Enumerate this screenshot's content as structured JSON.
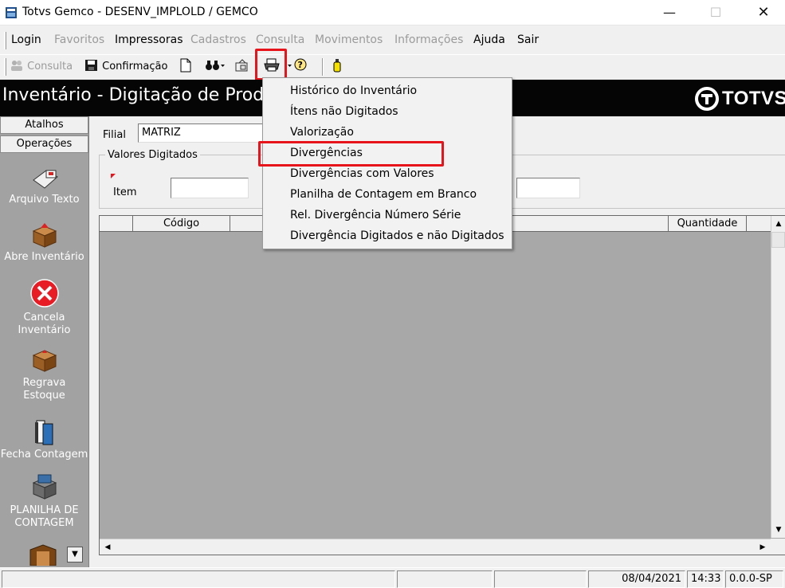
{
  "window": {
    "title": "Totvs Gemco - DESENV_IMPLOLD / GEMCO"
  },
  "menubar": {
    "items": [
      {
        "label": "Login",
        "enabled": true
      },
      {
        "label": "Favoritos",
        "enabled": false
      },
      {
        "label": "Impressoras",
        "enabled": true
      },
      {
        "label": "Cadastros",
        "enabled": false
      },
      {
        "label": "Consulta",
        "enabled": false
      },
      {
        "label": "Movimentos",
        "enabled": false
      },
      {
        "label": "Informações",
        "enabled": false
      },
      {
        "label": "Ajuda",
        "enabled": true
      },
      {
        "label": "Sair",
        "enabled": true
      }
    ]
  },
  "toolbar": {
    "consulta_label": "Consulta",
    "confirmacao_label": "Confirmação"
  },
  "header": {
    "title": "Inventário - Digitação de Produtos",
    "brand": "TOTVS"
  },
  "sidebar": {
    "tabs": [
      "Atalhos",
      "Operações"
    ],
    "buttons": [
      {
        "label": "Arquivo Texto",
        "icon": "text-file-icon"
      },
      {
        "label": "Abre Inventário",
        "icon": "open-box-icon"
      },
      {
        "label": "Cancela Inventário",
        "icon": "cancel-icon"
      },
      {
        "label": "Regrava Estoque",
        "icon": "box-icon"
      },
      {
        "label": "Fecha Contagem",
        "icon": "books-icon"
      },
      {
        "label": "PLANILHA DE CONTAGEM",
        "icon": "spreadsheet-icon"
      }
    ]
  },
  "form": {
    "filial_label": "Filial",
    "filial_value": "MATRIZ",
    "group_title": "Valores Digitados",
    "item_label": "Item",
    "item_value": "",
    "other_value": ""
  },
  "grid": {
    "columns": [
      "",
      "Código",
      "Quantidade"
    ]
  },
  "dropdown": {
    "items": [
      "Histórico do Inventário",
      "Ítens não Digitados",
      "Valorização",
      "Divergências",
      "Divergências com Valores",
      "Planilha de Contagem em Branco",
      "Rel. Divergência Número Série",
      "Divergência Digitados e não Digitados"
    ],
    "highlighted_index": 3
  },
  "statusbar": {
    "date": "08/04/2021",
    "time": "14:33",
    "version": "0.0.0-SP"
  },
  "colors": {
    "highlight": "#e8141b",
    "header_bg": "#050505",
    "sidebar_bg": "#a2a2a2"
  }
}
